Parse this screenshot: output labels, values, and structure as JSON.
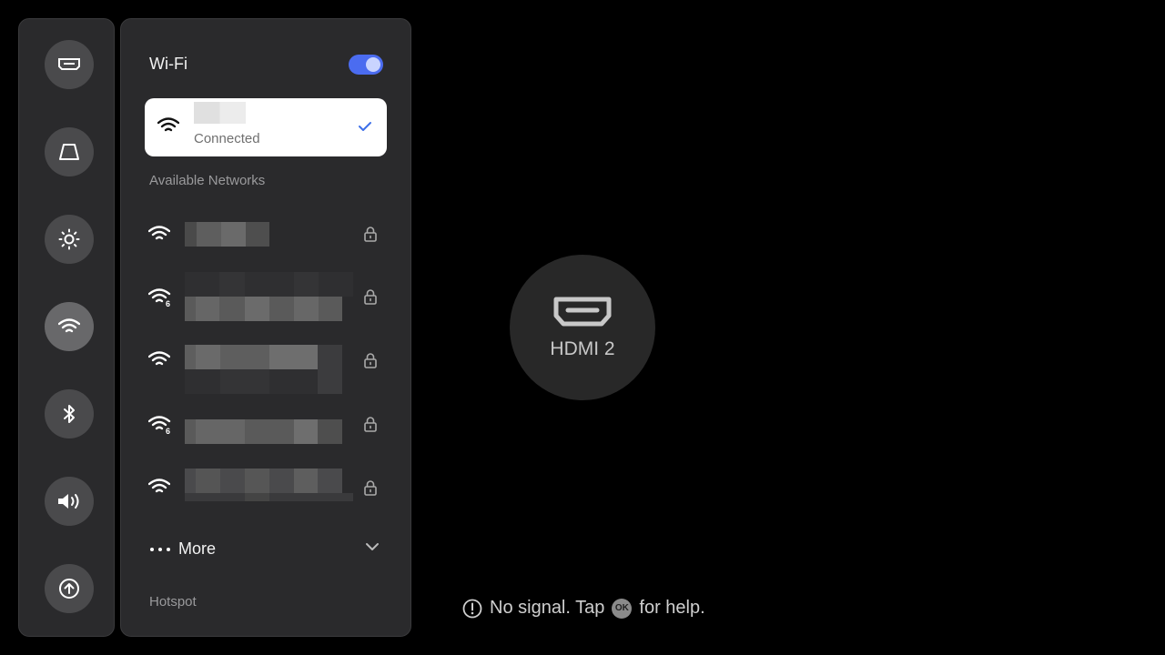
{
  "rail": {
    "items": [
      {
        "icon": "hdmi-source-icon"
      },
      {
        "icon": "keystone-icon"
      },
      {
        "icon": "brightness-icon"
      },
      {
        "icon": "wifi-icon",
        "active": true
      },
      {
        "icon": "bluetooth-icon"
      },
      {
        "icon": "volume-icon"
      },
      {
        "icon": "upload-icon"
      }
    ]
  },
  "wifi_panel": {
    "title": "Wi-Fi",
    "enabled": true,
    "accent_color": "#4b6cf0",
    "connected": {
      "status": "Connected",
      "checked": true
    },
    "available_label": "Available Networks",
    "networks": [
      {
        "secured": true
      },
      {
        "secured": true,
        "wifi6": true
      },
      {
        "secured": true
      },
      {
        "secured": true,
        "wifi6": true
      },
      {
        "secured": true
      }
    ],
    "more_label": "More",
    "hotspot_label": "Hotspot"
  },
  "source": {
    "label": "HDMI 2",
    "icon": "hdmi-icon"
  },
  "help": {
    "text_before": "No signal. Tap",
    "ok_key": "OK",
    "text_after": "for help."
  }
}
